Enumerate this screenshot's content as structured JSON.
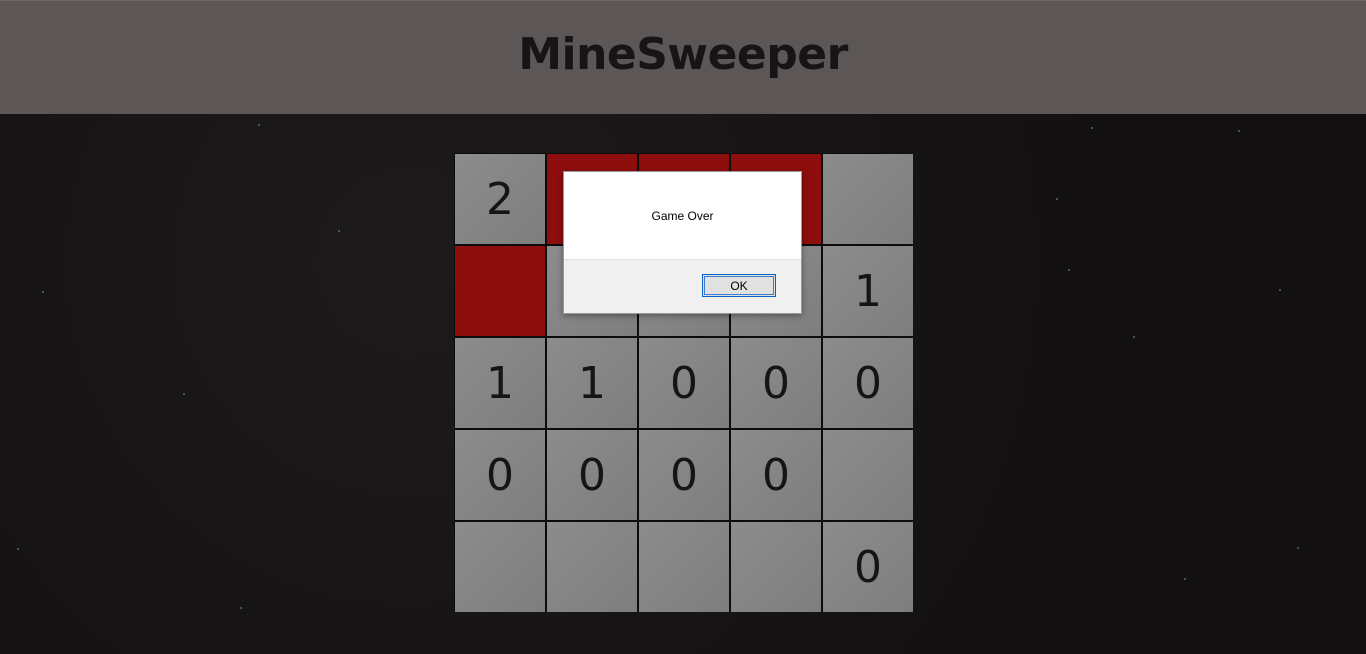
{
  "header": {
    "title": "MineSweeper"
  },
  "board": {
    "rows": 5,
    "cols": 5,
    "cells": [
      {
        "text": "2",
        "state": "revealed"
      },
      {
        "text": "",
        "state": "mine"
      },
      {
        "text": "",
        "state": "mine"
      },
      {
        "text": "",
        "state": "mine"
      },
      {
        "text": "",
        "state": "hidden"
      },
      {
        "text": "",
        "state": "mine"
      },
      {
        "text": "",
        "state": "hidden"
      },
      {
        "text": "",
        "state": "hidden"
      },
      {
        "text": "",
        "state": "hidden"
      },
      {
        "text": "1",
        "state": "revealed"
      },
      {
        "text": "1",
        "state": "revealed"
      },
      {
        "text": "1",
        "state": "revealed"
      },
      {
        "text": "0",
        "state": "revealed"
      },
      {
        "text": "0",
        "state": "revealed"
      },
      {
        "text": "0",
        "state": "revealed"
      },
      {
        "text": "0",
        "state": "revealed"
      },
      {
        "text": "0",
        "state": "revealed"
      },
      {
        "text": "0",
        "state": "revealed"
      },
      {
        "text": "0",
        "state": "revealed"
      },
      {
        "text": "",
        "state": "hidden"
      },
      {
        "text": "",
        "state": "hidden"
      },
      {
        "text": "",
        "state": "hidden"
      },
      {
        "text": "",
        "state": "hidden"
      },
      {
        "text": "",
        "state": "hidden"
      },
      {
        "text": "0",
        "state": "revealed"
      }
    ]
  },
  "dialog": {
    "message": "Game Over",
    "ok_label": "OK"
  },
  "colors": {
    "mine": "#8e0e0e",
    "cell": "#868686",
    "header": "#5c5756",
    "background": "#141212"
  }
}
